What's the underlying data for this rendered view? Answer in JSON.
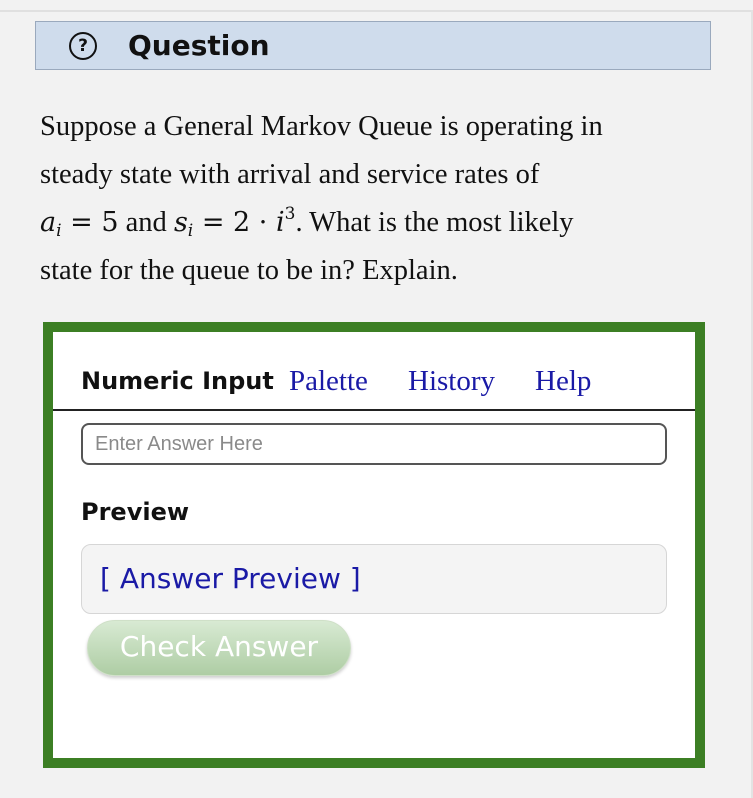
{
  "question_header": {
    "icon": "question-circle-icon",
    "title": "Question"
  },
  "problem": {
    "line1": "Suppose a General Markov Queue is operating in",
    "line2": "steady state with arrival and service rates of",
    "math_a": "a",
    "math_a_sub": "i",
    "math_eq1": "= 5",
    "and_word": "and",
    "math_s": "s",
    "math_s_sub": "i",
    "math_eq2": "= 2 · ",
    "math_i": "i",
    "math_exp": "3",
    "line3_rest": ". What is the most likely",
    "line4": "state for the queue to be in? Explain."
  },
  "answer_panel": {
    "border_color": "#3c7f24",
    "tabs": {
      "active": "Numeric Input",
      "palette": "Palette",
      "history": "History",
      "help": "Help"
    },
    "input": {
      "value": "",
      "placeholder": "Enter Answer Here"
    },
    "preview_label": "Preview",
    "preview_text": "[ Answer Preview ]",
    "check_button": "Check Answer"
  },
  "colors": {
    "link": "#1a1aa6",
    "header_bg": "#cfdcec",
    "page_bg": "#f2f2f2"
  }
}
